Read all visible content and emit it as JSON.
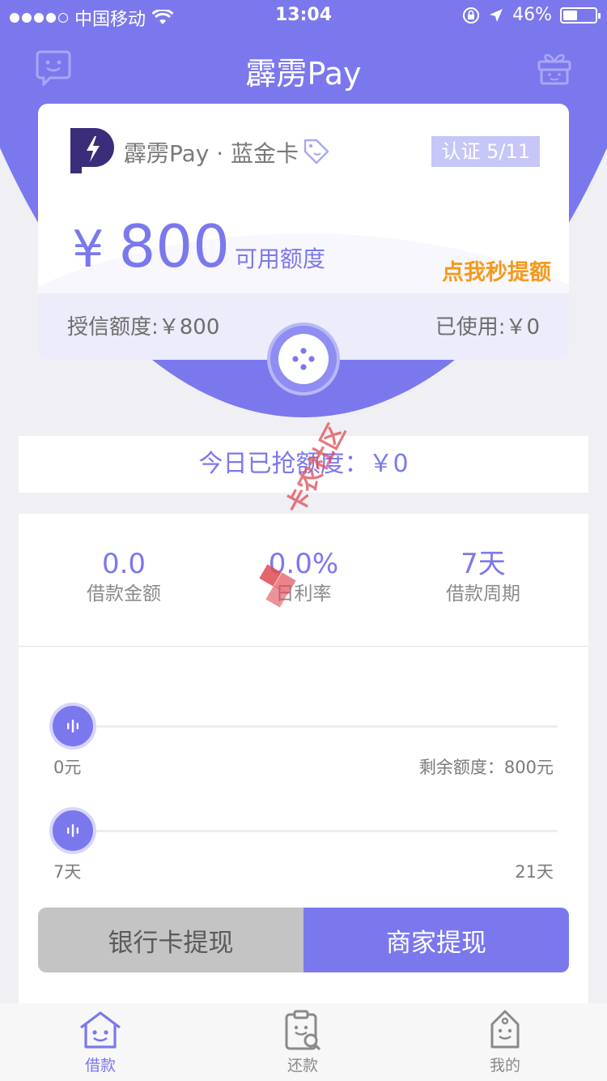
{
  "status_bar": {
    "carrier": "中国移动",
    "time": "13:04",
    "battery_percent": "46%",
    "battery_level": 0.46
  },
  "nav": {
    "title": "霹雳Pay",
    "left_icon": "chat-face-icon",
    "right_icon": "gift-icon"
  },
  "card": {
    "name": "霹雳Pay · 蓝金卡",
    "cert_badge": "认证 5/11",
    "currency": "¥",
    "amount": "800",
    "amount_label": "可用额度",
    "boost_link": "点我秒提额",
    "credit_line": "授信额度:￥800",
    "used_line": "已使用:￥0"
  },
  "today": {
    "text": "今日已抢额度：￥0"
  },
  "stats": [
    {
      "value": "0.0",
      "label": "借款金额"
    },
    {
      "value": "0.0%",
      "label": "日利率"
    },
    {
      "value": "7天",
      "label": "借款周期"
    }
  ],
  "amount_slider": {
    "min_label": "0元",
    "max_label": "剩余额度：800元",
    "value": 0
  },
  "period_slider": {
    "min_label": "7天",
    "max_label": "21天",
    "value": 7
  },
  "buttons": {
    "bank": "银行卡提现",
    "merchant": "商家提现"
  },
  "tabs": [
    {
      "label": "借款",
      "icon": "home-face-icon",
      "active": true
    },
    {
      "label": "还款",
      "icon": "clipboard-search-icon",
      "active": false
    },
    {
      "label": "我的",
      "icon": "tag-face-icon",
      "active": false
    }
  ],
  "watermark": "卡农社区",
  "colors": {
    "accent": "#7b78ee",
    "highlight": "#f39a1d",
    "inactive_tab": "#8a8a8a"
  }
}
